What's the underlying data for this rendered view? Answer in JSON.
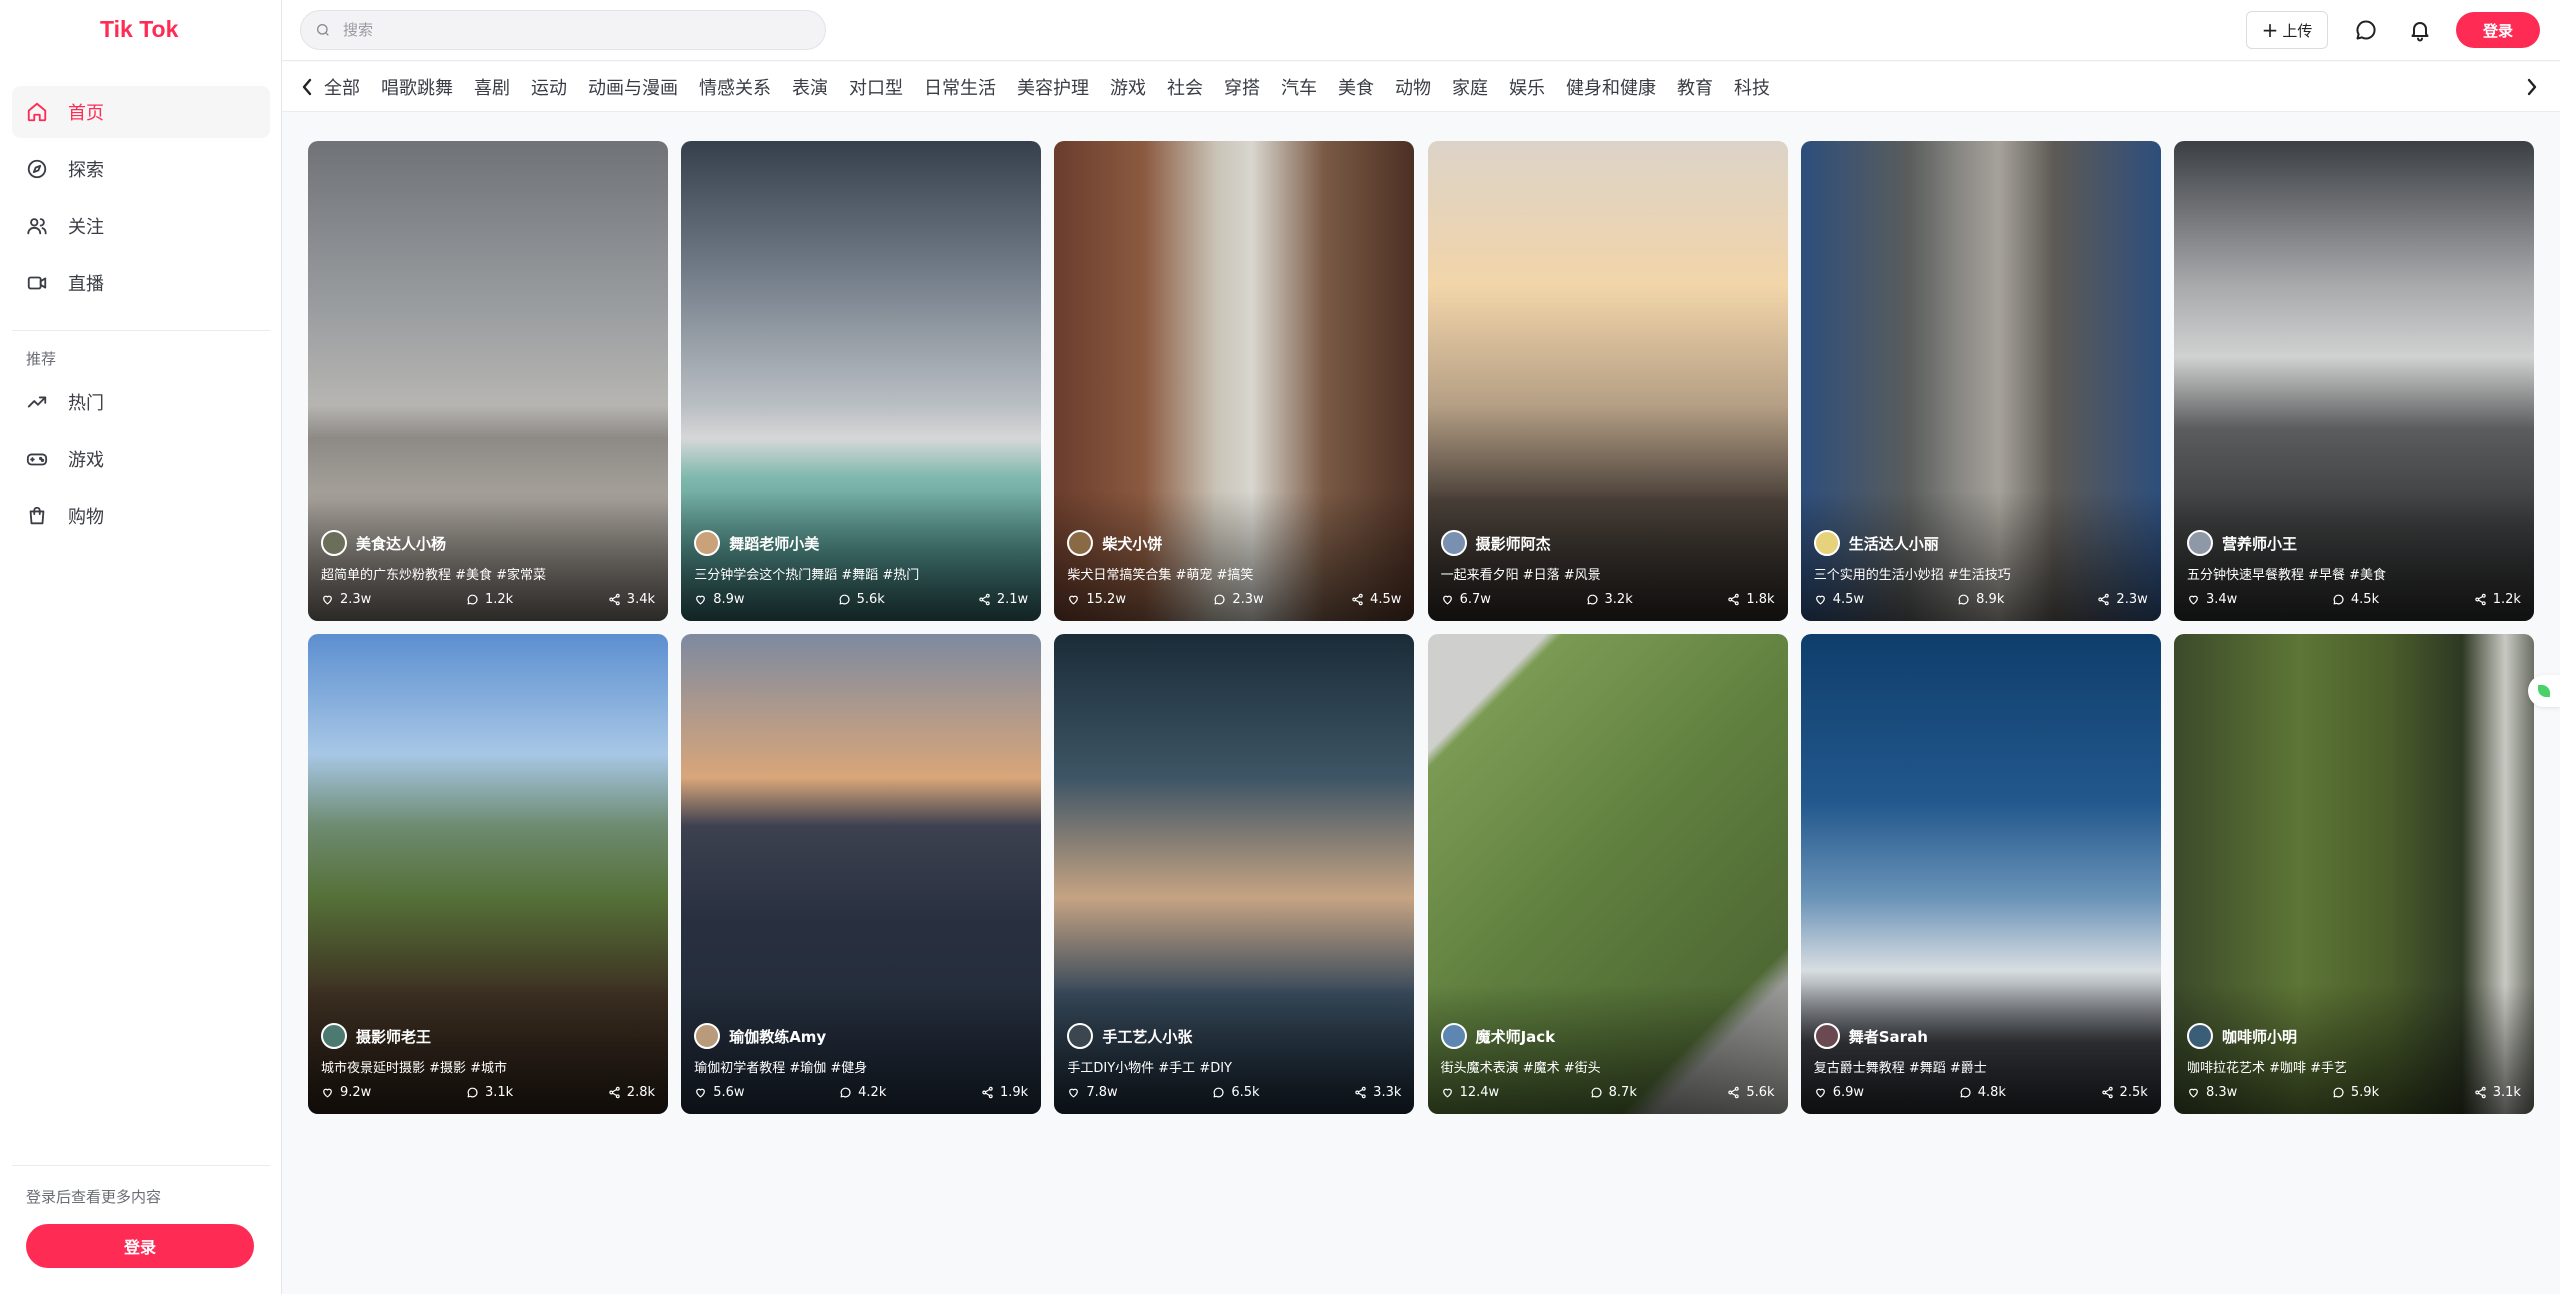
{
  "app": {
    "title": "Tik Tok"
  },
  "sidebar": {
    "items": [
      {
        "label": "首页",
        "icon": "home-icon",
        "active": true
      },
      {
        "label": "探索",
        "icon": "compass-icon"
      },
      {
        "label": "关注",
        "icon": "users-icon"
      },
      {
        "label": "直播",
        "icon": "video-icon"
      }
    ],
    "section_title": "推荐",
    "recommend": [
      {
        "label": "热门",
        "icon": "trending-icon"
      },
      {
        "label": "游戏",
        "icon": "gamepad-icon"
      },
      {
        "label": "购物",
        "icon": "shopping-bag-icon"
      }
    ],
    "login_hint": "登录后查看更多内容",
    "login_button": "登录"
  },
  "header": {
    "search_placeholder": "搜索",
    "upload_label": "上传",
    "login_label": "登录"
  },
  "categories": [
    "全部",
    "唱歌跳舞",
    "喜剧",
    "运动",
    "动画与漫画",
    "情感关系",
    "表演",
    "对口型",
    "日常生活",
    "美容护理",
    "游戏",
    "社会",
    "穿搭",
    "汽车",
    "美食",
    "动物",
    "家庭",
    "娱乐",
    "健身和健康",
    "教育",
    "科技"
  ],
  "videos": [
    {
      "author": "美食达人小杨",
      "desc": "超简单的广东炒粉教程 #美食 #家常菜",
      "likes": "2.3w",
      "comments": "1.2k",
      "shares": "3.4k"
    },
    {
      "author": "舞蹈老师小美",
      "desc": "三分钟学会这个热门舞蹈 #舞蹈 #热门",
      "likes": "8.9w",
      "comments": "5.6k",
      "shares": "2.1w"
    },
    {
      "author": "柴犬小饼",
      "desc": "柴犬日常搞笑合集 #萌宠 #搞笑",
      "likes": "15.2w",
      "comments": "2.3w",
      "shares": "4.5w"
    },
    {
      "author": "摄影师阿杰",
      "desc": "一起来看夕阳 #日落 #风景",
      "likes": "6.7w",
      "comments": "3.2k",
      "shares": "1.8k"
    },
    {
      "author": "生活达人小丽",
      "desc": "三个实用的生活小妙招 #生活技巧",
      "likes": "4.5w",
      "comments": "8.9k",
      "shares": "2.3w"
    },
    {
      "author": "营养师小王",
      "desc": "五分钟快速早餐教程 #早餐 #美食",
      "likes": "3.4w",
      "comments": "4.5k",
      "shares": "1.2k"
    },
    {
      "author": "摄影师老王",
      "desc": "城市夜景延时摄影 #摄影 #城市",
      "likes": "9.2w",
      "comments": "3.1k",
      "shares": "2.8k"
    },
    {
      "author": "瑜伽教练Amy",
      "desc": "瑜伽初学者教程 #瑜伽 #健身",
      "likes": "5.6w",
      "comments": "4.2k",
      "shares": "1.9k"
    },
    {
      "author": "手工艺人小张",
      "desc": "手工DIY小物件 #手工 #DIY",
      "likes": "7.8w",
      "comments": "6.5k",
      "shares": "3.3k"
    },
    {
      "author": "魔术师Jack",
      "desc": "街头魔术表演 #魔术 #街头",
      "likes": "12.4w",
      "comments": "8.7k",
      "shares": "5.6k"
    },
    {
      "author": "舞者Sarah",
      "desc": "复古爵士舞教程 #舞蹈 #爵士",
      "likes": "6.9w",
      "comments": "4.8k",
      "shares": "2.5k"
    },
    {
      "author": "咖啡师小明",
      "desc": "咖啡拉花艺术 #咖啡 #手艺",
      "likes": "8.3w",
      "comments": "5.9k",
      "shares": "3.1k"
    }
  ],
  "colors": {
    "accent": "#fe2c55",
    "text": "#161823",
    "muted": "#6b6d75"
  }
}
